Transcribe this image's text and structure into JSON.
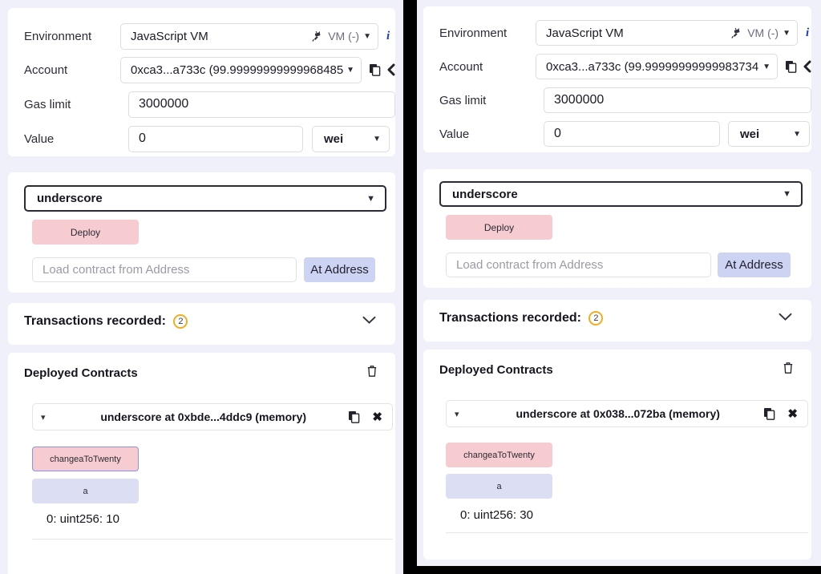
{
  "panels": [
    {
      "id": "left",
      "settings": {
        "environment": {
          "label": "Environment",
          "value": "JavaScript VM",
          "status": "VM (-)",
          "plug_icon": "plug-icon",
          "caret": "▼",
          "info_icon": "info-icon"
        },
        "account": {
          "label": "Account",
          "value": "0xca3...a733c (99.99999999999968485",
          "caret": "▼",
          "copy_icon": "copy-icon",
          "key_icon": "key-icon"
        },
        "gas_limit": {
          "label": "Gas limit",
          "value": "3000000"
        },
        "value": {
          "label": "Value",
          "value": "0",
          "unit": "wei",
          "caret": "▼"
        }
      },
      "deploy": {
        "contract_select": "underscore",
        "contract_select_caret": "▼",
        "deploy_label": "Deploy",
        "address_placeholder": "Load contract from Address",
        "at_address_label": "At Address"
      },
      "transactions": {
        "title": "Transactions recorded:",
        "count": "2",
        "chevron": "chevron-down"
      },
      "deployed": {
        "title": "Deployed Contracts",
        "trash_icon": "trash-icon",
        "contract_name": "underscore at 0xbde...4ddc9 (memory)",
        "mini_caret": "▾",
        "copy_icon": "copy-icon",
        "close_icon": "✖",
        "write_fn": "changeaToTwenty",
        "read_fn": "a",
        "return_value": "0: uint256: 10",
        "write_fn_focused": true
      }
    },
    {
      "id": "right",
      "settings": {
        "environment": {
          "label": "Environment",
          "value": "JavaScript VM",
          "status": "VM (-)",
          "plug_icon": "plug-icon",
          "caret": "▼",
          "info_icon": "info-icon"
        },
        "account": {
          "label": "Account",
          "value": "0xca3...a733c (99.99999999999983734",
          "caret": "▼",
          "copy_icon": "copy-icon",
          "key_icon": "key-icon"
        },
        "gas_limit": {
          "label": "Gas limit",
          "value": "3000000"
        },
        "value": {
          "label": "Value",
          "value": "0",
          "unit": "wei",
          "caret": "▼"
        }
      },
      "deploy": {
        "contract_select": "underscore",
        "contract_select_caret": "▼",
        "deploy_label": "Deploy",
        "address_placeholder": "Load contract from Address",
        "at_address_label": "At Address"
      },
      "transactions": {
        "title": "Transactions recorded:",
        "count": "2",
        "chevron": "chevron-down"
      },
      "deployed": {
        "title": "Deployed Contracts",
        "trash_icon": "trash-icon",
        "contract_name": "underscore at 0x038...072ba (memory)",
        "mini_caret": "▾",
        "copy_icon": "copy-icon",
        "close_icon": "✖",
        "write_fn": "changeaToTwenty",
        "read_fn": "a",
        "return_value": "0: uint256: 30",
        "write_fn_focused": false
      }
    }
  ],
  "colors": {
    "page_background": "#f0f0fb",
    "card_background": "#ffffff",
    "deploy_pink": "#f7ccd0",
    "at_address_blue": "#cdd3f2",
    "read_fn_blue": "#dcdff4",
    "badge_orange": "#f0ad20",
    "info_blue": "#1a3bd0",
    "divider_black": "#000000"
  }
}
